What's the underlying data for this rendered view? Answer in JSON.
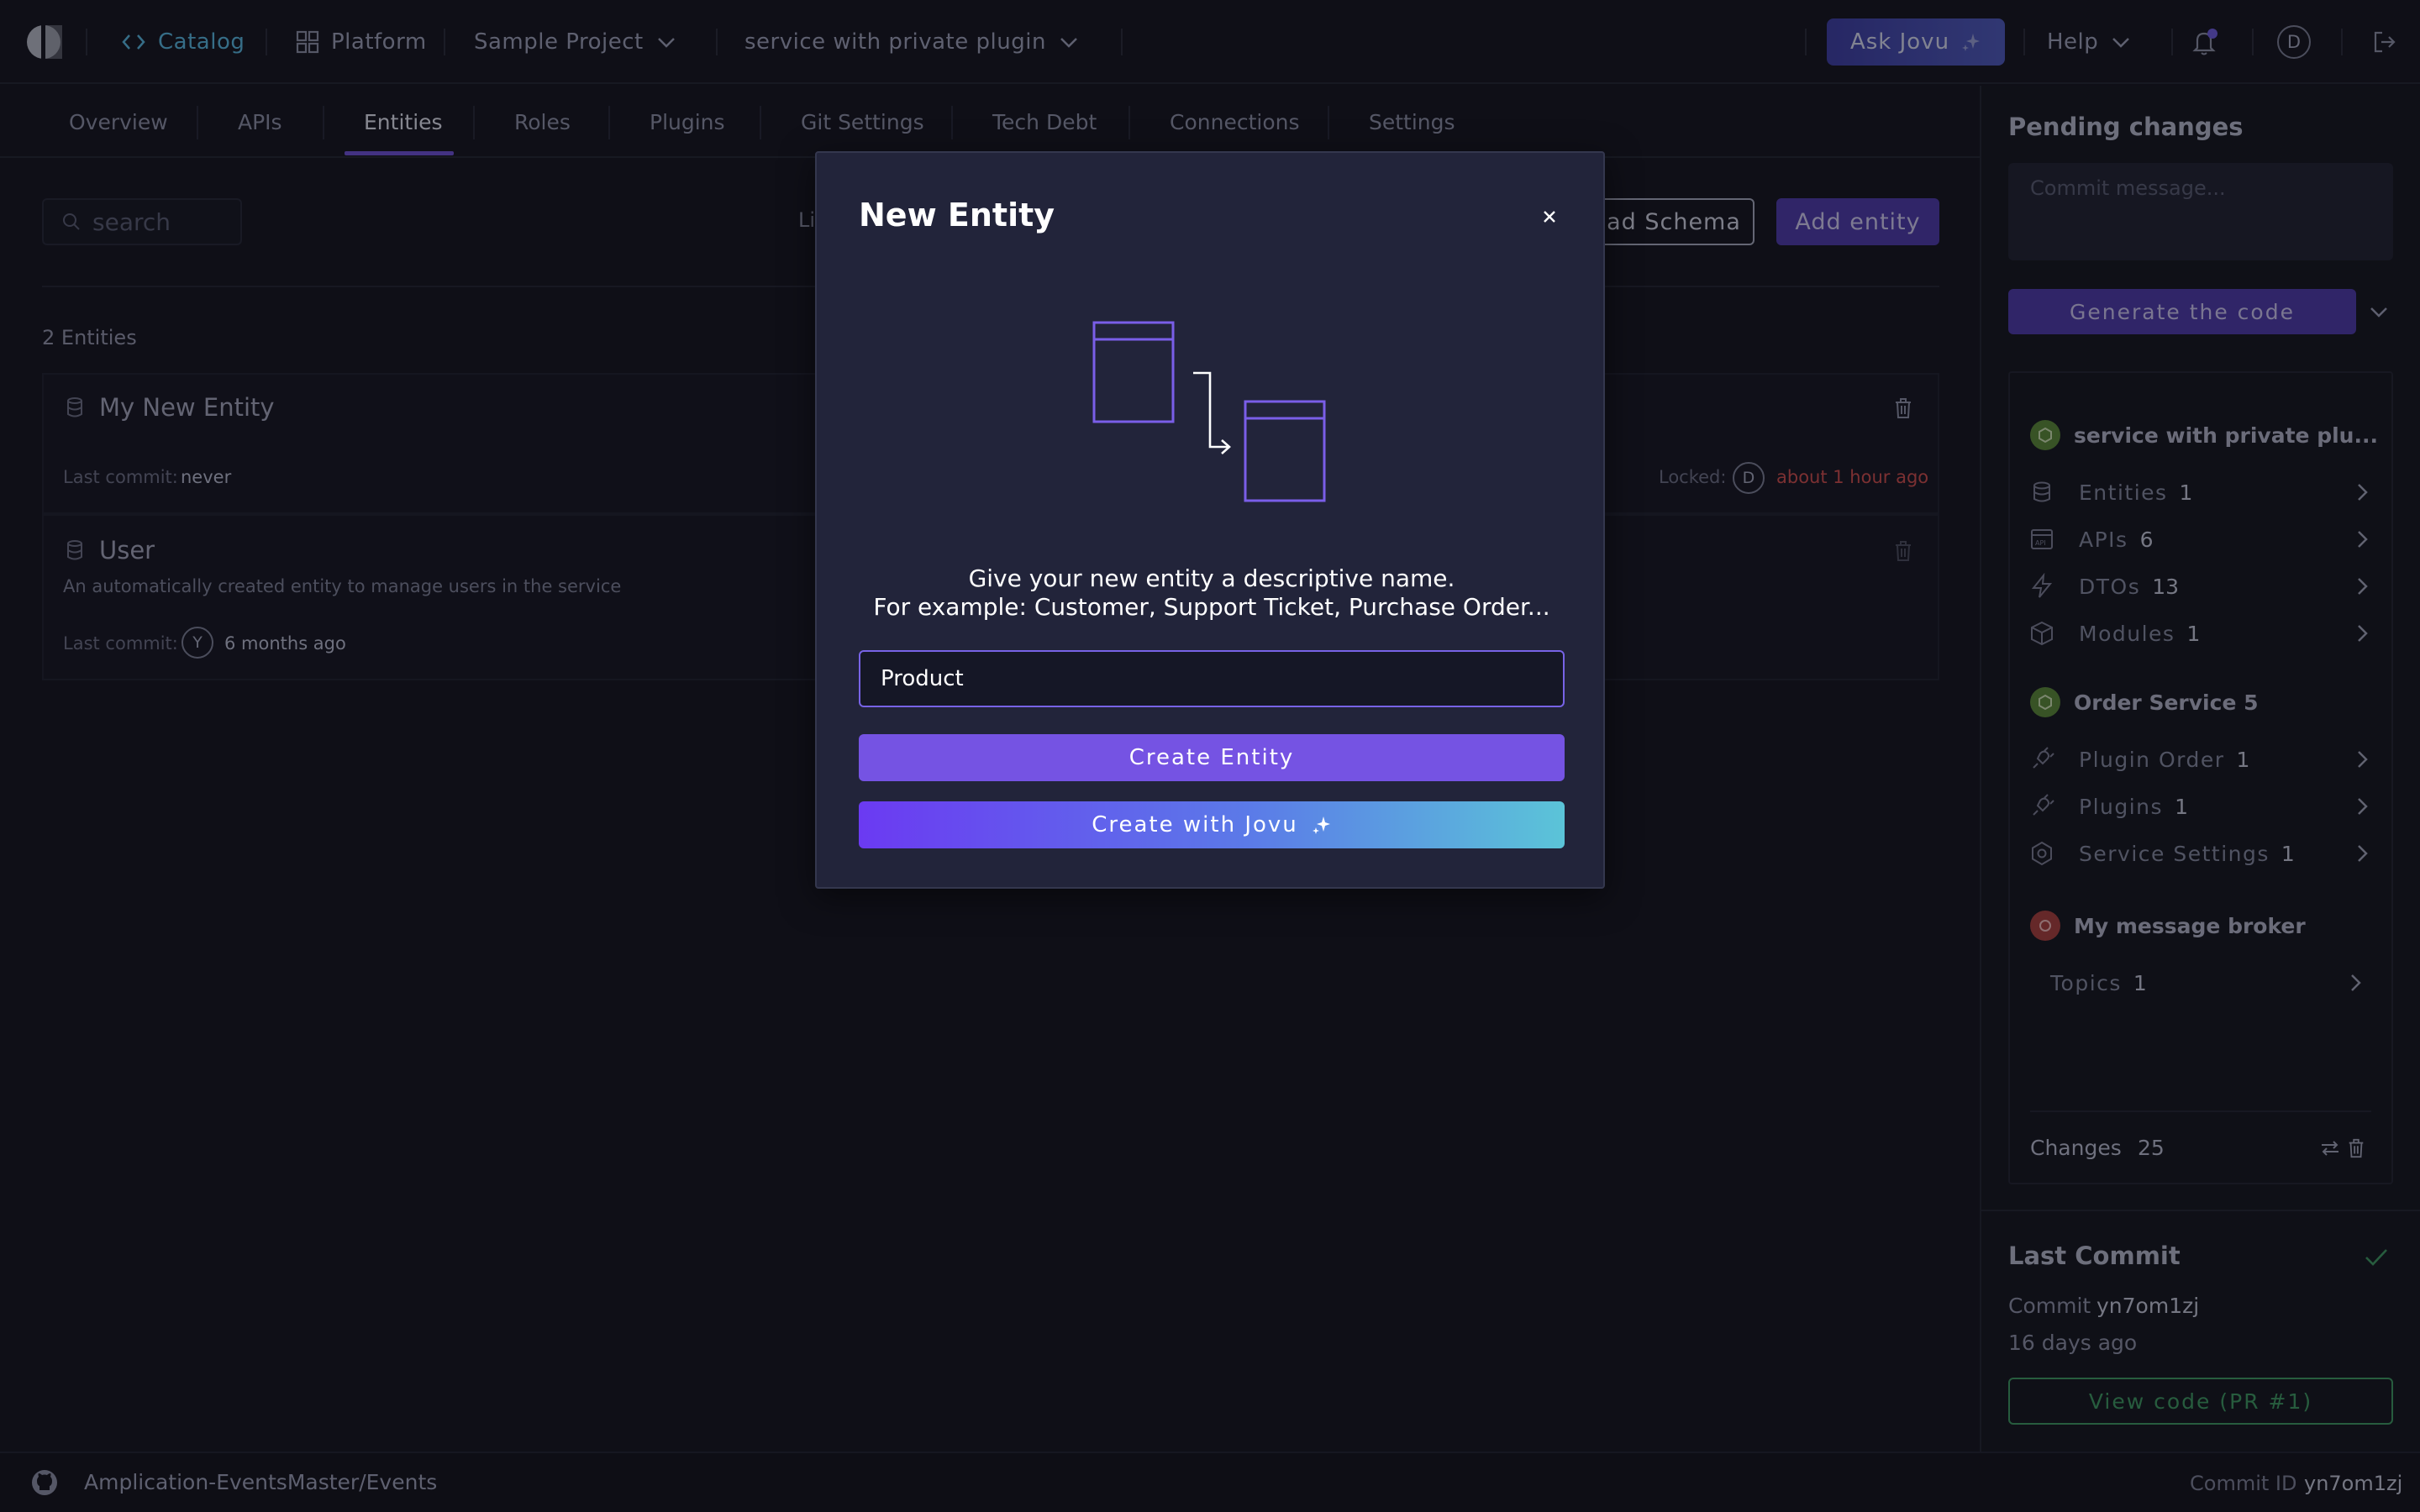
{
  "topbar": {
    "catalog": "Catalog",
    "platform": "Platform",
    "project": "Sample Project",
    "service": "service with private plugin",
    "ask_jovu": "Ask Jovu",
    "help": "Help",
    "avatar_initial": "D"
  },
  "tabs": [
    {
      "label": "Overview"
    },
    {
      "label": "APIs"
    },
    {
      "label": "Entities"
    },
    {
      "label": "Roles"
    },
    {
      "label": "Plugins"
    },
    {
      "label": "Git Settings"
    },
    {
      "label": "Tech Debt"
    },
    {
      "label": "Connections"
    },
    {
      "label": "Settings"
    }
  ],
  "active_tab": "Entities",
  "main": {
    "search_placeholder": "search",
    "partial_list_label": "Lis",
    "upload_schema": "ad Schema",
    "add_entity": "Add entity",
    "entity_count": "2 Entities",
    "entities": [
      {
        "name": "My New Entity",
        "description": "",
        "last_commit_label": "Last commit:",
        "last_commit_value": "never",
        "locked_label": "Locked:",
        "locked_avatar": "D",
        "locked_time": "about 1 hour ago"
      },
      {
        "name": "User",
        "description": "An automatically created entity to manage users in the service",
        "last_commit_label": "Last commit:",
        "last_commit_avatar": "Y",
        "last_commit_value": "6 months ago"
      }
    ]
  },
  "pending": {
    "title": "Pending changes",
    "commit_placeholder": "Commit message...",
    "generate": "Generate the code",
    "groups": [
      {
        "name": "service with private plu...",
        "color": "#5c8a3a",
        "items": [
          {
            "label": "Entities",
            "count": "1",
            "icon": "database-icon"
          },
          {
            "label": "APIs",
            "count": "6",
            "icon": "api-icon"
          },
          {
            "label": "DTOs",
            "count": "13",
            "icon": "lightning-icon"
          },
          {
            "label": "Modules",
            "count": "1",
            "icon": "cube-icon"
          }
        ]
      },
      {
        "name": "Order Service 5",
        "color": "#5c8a3a",
        "items": [
          {
            "label": "Plugin Order",
            "count": "1",
            "icon": "plug-icon"
          },
          {
            "label": "Plugins",
            "count": "1",
            "icon": "plug-icon"
          },
          {
            "label": "Service Settings",
            "count": "1",
            "icon": "gear-icon"
          }
        ]
      },
      {
        "name": "My message broker",
        "color": "#a9413f",
        "items": [
          {
            "label": "Topics",
            "count": "1",
            "icon": ""
          }
        ]
      }
    ],
    "changes_label": "Changes",
    "changes_count": "25"
  },
  "last_commit": {
    "title": "Last Commit",
    "commit_label": "Commit",
    "commit_id": "yn7om1zj",
    "time": "16 days ago",
    "view_code": "View code (PR #1)"
  },
  "footer": {
    "repo": "Amplication-EventsMaster/Events",
    "commit_id_label": "Commit ID",
    "commit_id": "yn7om1zj"
  },
  "modal": {
    "title": "New Entity",
    "description_line1": "Give your new entity a descriptive name.",
    "description_line2": "For example: Customer, Support Ticket, Purchase Order...",
    "input_value": "Product",
    "create_button": "Create Entity",
    "create_jovu_button": "Create with Jovu"
  },
  "colors": {
    "accent": "#7553e3",
    "catalog_link": "#58b7e0",
    "warning_time": "#d04f4f",
    "success": "#3f9a63"
  }
}
